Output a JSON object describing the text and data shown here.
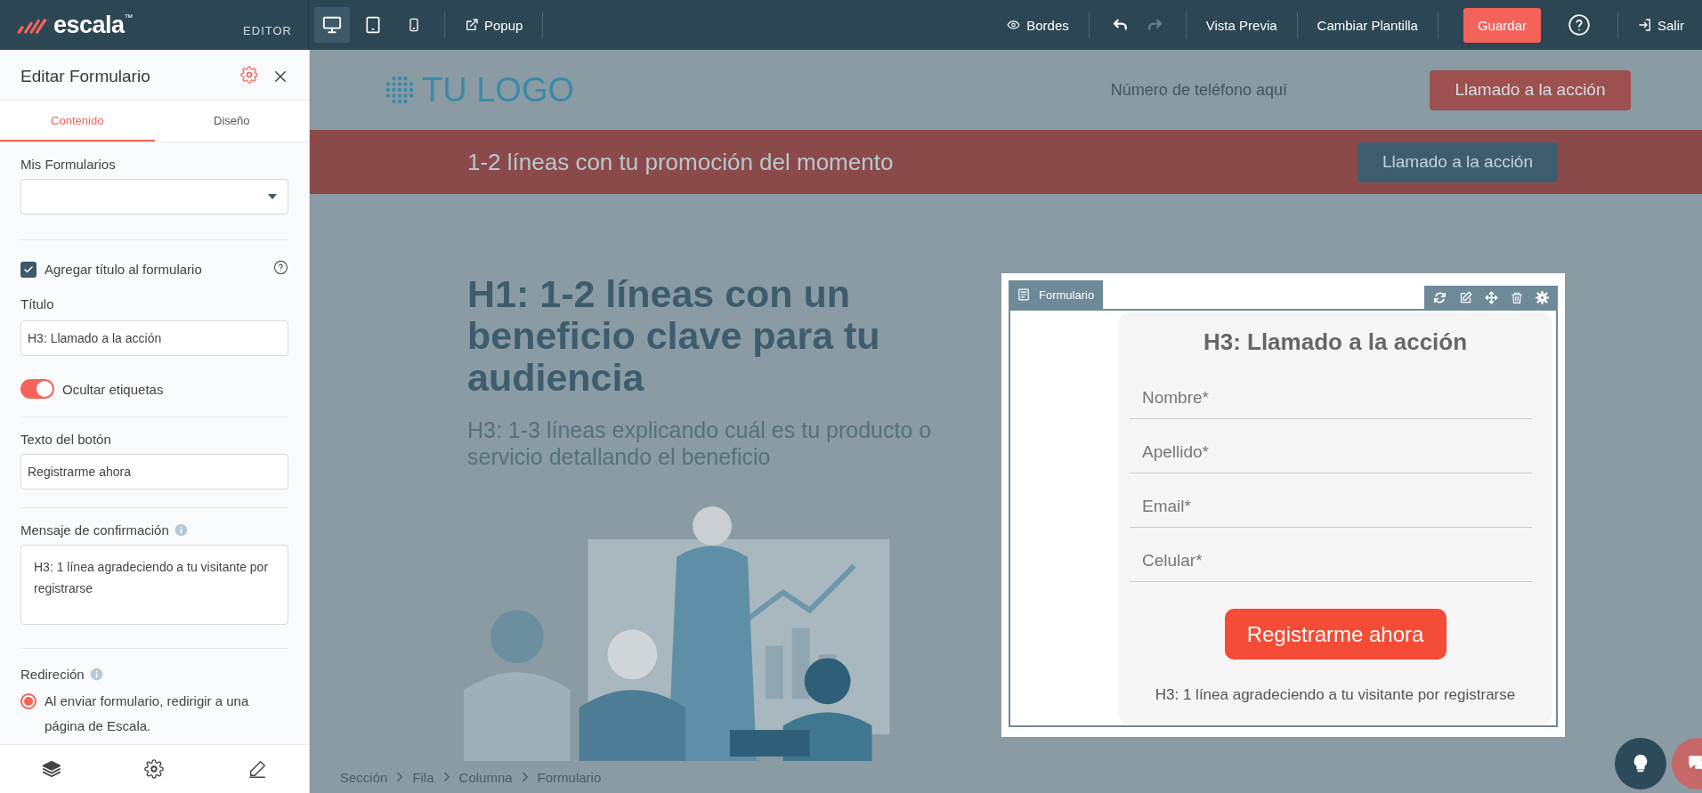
{
  "topbar": {
    "brand": "escala",
    "brand_mark": "™",
    "mode": "EDITOR",
    "devices": [
      {
        "kind": "desktop",
        "selected": true
      },
      {
        "kind": "tablet",
        "selected": false
      },
      {
        "kind": "mobile",
        "selected": false
      }
    ],
    "popup": "Popup",
    "borders": "Bordes",
    "undo": {
      "disabled": false
    },
    "redo": {
      "disabled": true
    },
    "preview": "Vista Previa",
    "change_template": "Cambiar Plantilla",
    "save": "Guardar",
    "exit": "Salir"
  },
  "panel": {
    "title": "Editar Formulario",
    "tabs": [
      {
        "label": "Contenido",
        "selected": true
      },
      {
        "label": "Diseño",
        "selected": false
      }
    ],
    "my_forms": {
      "label": "Mis Formularios"
    },
    "add_title": {
      "label": "Agregar título al formulario",
      "checked": true
    },
    "title_field": {
      "label": "Título",
      "value": "H3: Llamado a la acción"
    },
    "hide_labels": {
      "label": "Ocultar etiquetas",
      "on": true
    },
    "button_text": {
      "label": "Texto del botón",
      "value": "Registrarme ahora"
    },
    "confirmation": {
      "label": "Mensaje de confirmación",
      "value": "H3: 1 línea agradeciendo a tu visitante por registrarse"
    },
    "redirect": {
      "label": "Redireción",
      "options": [
        {
          "label": "Al enviar formulario, redirigir a una página de Escala.",
          "selected": true
        }
      ]
    }
  },
  "page": {
    "logo": "TU LOGO",
    "phone": "Número de teléfono aquí",
    "header_cta": "Llamado a la acción",
    "promo": {
      "text": "1-2 líneas con tu promoción del momento",
      "cta": "Llamado a la acción"
    },
    "hero": {
      "headline": "H1: 1-2 líneas con un beneficio clave para tu audiencia",
      "subheadline": "H3: 1-3 líneas explicando cuál es tu producto o servicio detallando el beneficio"
    },
    "form": {
      "tag": "Formulario",
      "title": "H3: Llamado a la acción",
      "fields": [
        {
          "placeholder": "Nombre*"
        },
        {
          "placeholder": "Apellido*"
        },
        {
          "placeholder": "Email*"
        },
        {
          "placeholder": "Celular*"
        }
      ],
      "submit": "Registrarme ahora",
      "confirmation": "H3: 1 línea agradeciendo a tu visitante por registrarse"
    }
  },
  "breadcrumb": [
    "Sección",
    "Fila",
    "Columna",
    "Formulario"
  ]
}
